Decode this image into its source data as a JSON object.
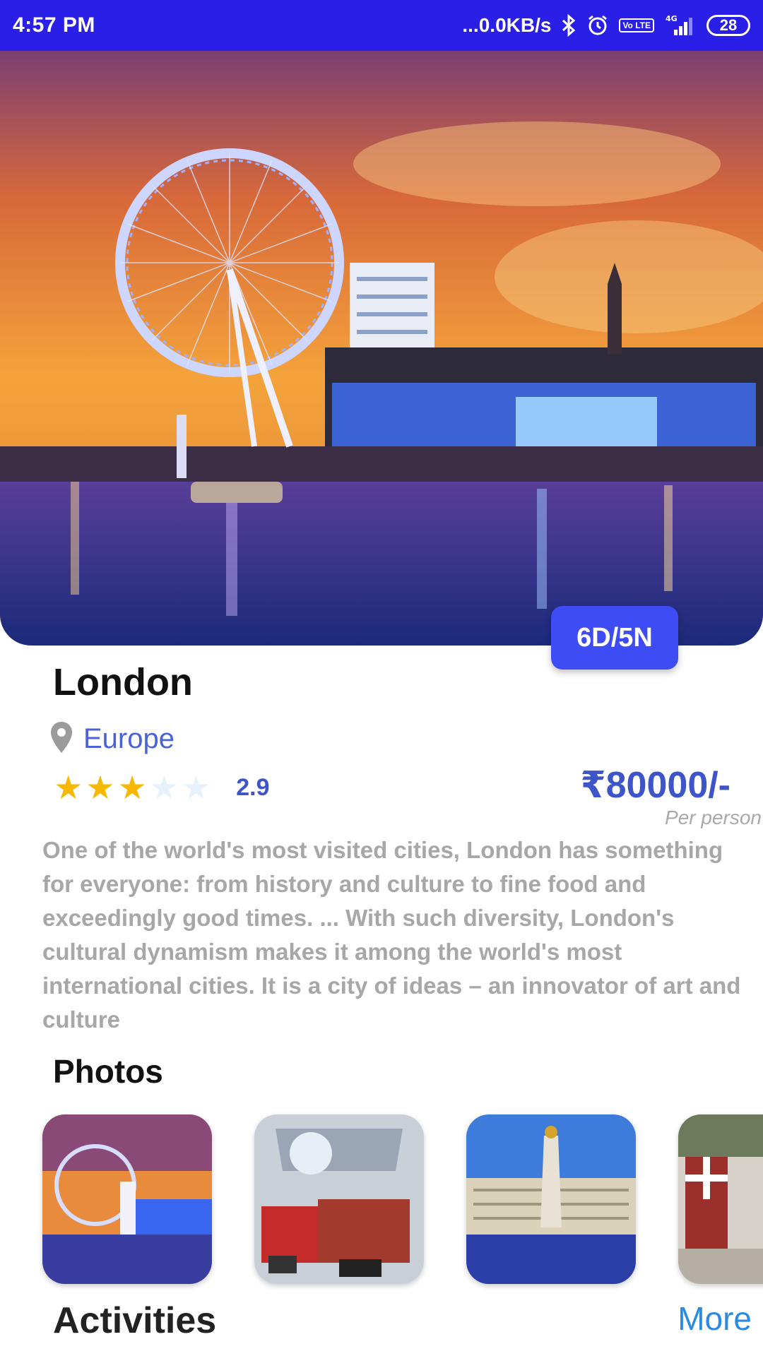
{
  "status_bar": {
    "time": "4:57 PM",
    "network_speed": "...0.0KB/s",
    "volte_label": "Vo LTE",
    "signal_label": "4G",
    "battery": "28"
  },
  "hero": {
    "duration_badge": "6D/5N"
  },
  "destination": {
    "name": "London",
    "region": "Europe",
    "rating": 2.9,
    "rating_text": "2.9",
    "stars_filled": 3,
    "stars_total": 5,
    "price": "₹80000/-",
    "price_note": "Per person",
    "description": "One of the world's most visited cities, London has something for everyone: from history and culture to fine food and exceedingly good times. ... With such diversity, London's cultural dynamism makes it among the world's most international cities. It is a city of ideas – an innovator of art and culture"
  },
  "photos": {
    "title": "Photos"
  },
  "activities": {
    "title": "Activities",
    "more_label": "More"
  },
  "colors": {
    "status_bar": "#2a1fe6",
    "accent": "#3d4cf4",
    "price": "#3d55c9",
    "star": "#f6b800",
    "link": "#2c8be0"
  }
}
